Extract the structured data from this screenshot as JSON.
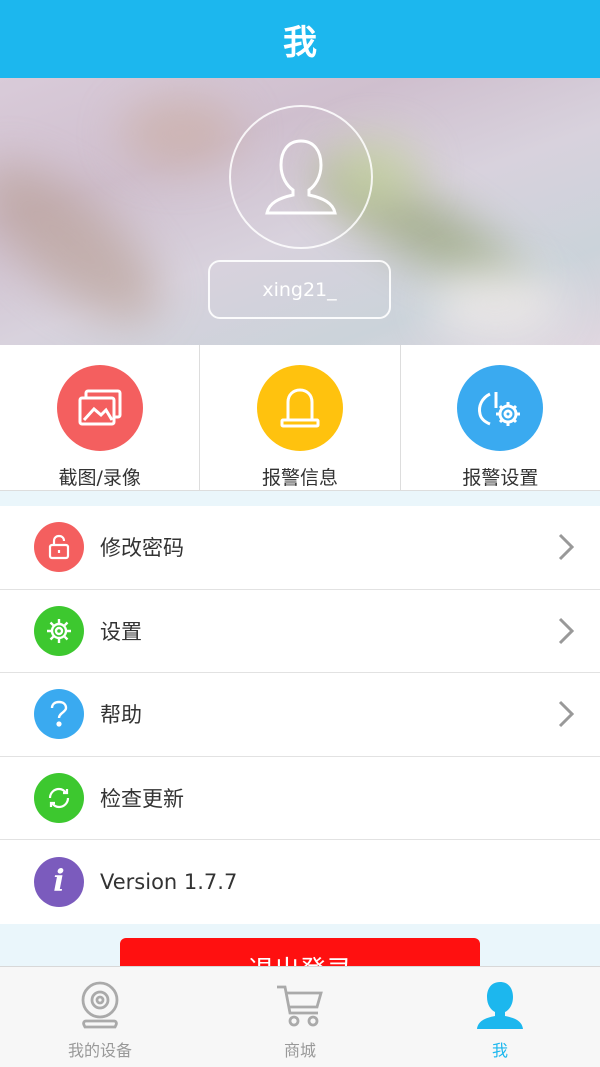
{
  "header": {
    "title": "我"
  },
  "profile": {
    "username": "xing21_"
  },
  "quick_actions": [
    {
      "label": "截图/录像",
      "icon": "gallery-icon",
      "color": "#f45f5f"
    },
    {
      "label": "报警信息",
      "icon": "alarm-light-icon",
      "color": "#ffc20e"
    },
    {
      "label": "报警设置",
      "icon": "alarm-settings-icon",
      "color": "#3aaaf0"
    }
  ],
  "menu": [
    {
      "label": "修改密码",
      "icon": "lock-icon",
      "color": "#f45f5f",
      "chevron": true
    },
    {
      "label": "设置",
      "icon": "gear-icon",
      "color": "#3dc82f",
      "chevron": true
    },
    {
      "label": "帮助",
      "icon": "help-icon",
      "color": "#3aaaf0",
      "chevron": true
    },
    {
      "label": "检查更新",
      "icon": "refresh-icon",
      "color": "#3dc82f",
      "chevron": false
    },
    {
      "label": "Version 1.7.7",
      "icon": "info-icon",
      "color": "#7b5bbd",
      "chevron": false
    }
  ],
  "logout": {
    "label": "退出登录"
  },
  "tabs": [
    {
      "label": "我的设备",
      "icon": "camera-icon",
      "active": false
    },
    {
      "label": "商城",
      "icon": "cart-icon",
      "active": false
    },
    {
      "label": "我",
      "icon": "person-icon",
      "active": true
    }
  ],
  "colors": {
    "accent": "#1cb7ee",
    "logout": "#ff1010"
  }
}
